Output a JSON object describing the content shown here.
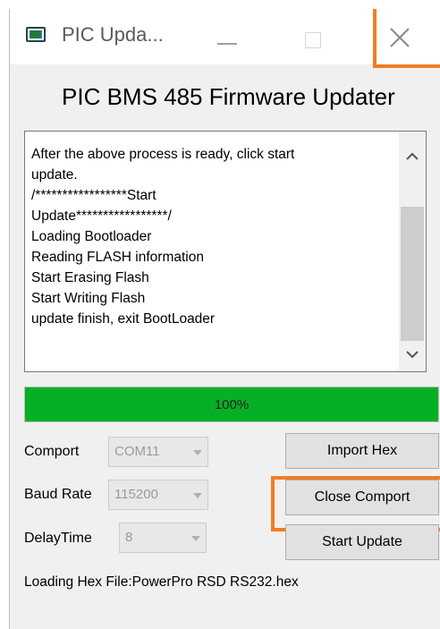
{
  "window": {
    "title": "PIC Upda...",
    "icons": {
      "app": "app-window-icon",
      "minimize": "minimize-icon",
      "maximize": "maximize-icon",
      "close": "close-icon"
    }
  },
  "main": {
    "heading": "PIC BMS 485 Firmware Updater"
  },
  "log": {
    "lines": [
      "After the above process is ready, click start",
      "update.",
      "",
      "",
      "/*****************Start",
      "Update*****************/",
      "Loading Bootloader",
      "Reading FLASH information",
      "Start Erasing Flash",
      "Start Writing Flash",
      "update finish, exit BootLoader"
    ],
    "icons": {
      "scroll_up": "chevron-up-icon",
      "scroll_down": "chevron-down-icon"
    }
  },
  "progress": {
    "value": 1.0,
    "label": "100%",
    "color": "#06b025"
  },
  "settings": {
    "comport": {
      "label": "Comport",
      "value": "COM11"
    },
    "baud_rate": {
      "label": "Baud Rate",
      "value": "115200"
    },
    "delay_time": {
      "label": "DelayTime",
      "value": "8"
    }
  },
  "buttons": {
    "import_hex": "Import Hex",
    "close_comport": "Close Comport",
    "start_update": "Start Update"
  },
  "status": {
    "text": "Loading Hex File:PowerPro RSD RS232.hex"
  },
  "highlight_color": "#f07d22"
}
